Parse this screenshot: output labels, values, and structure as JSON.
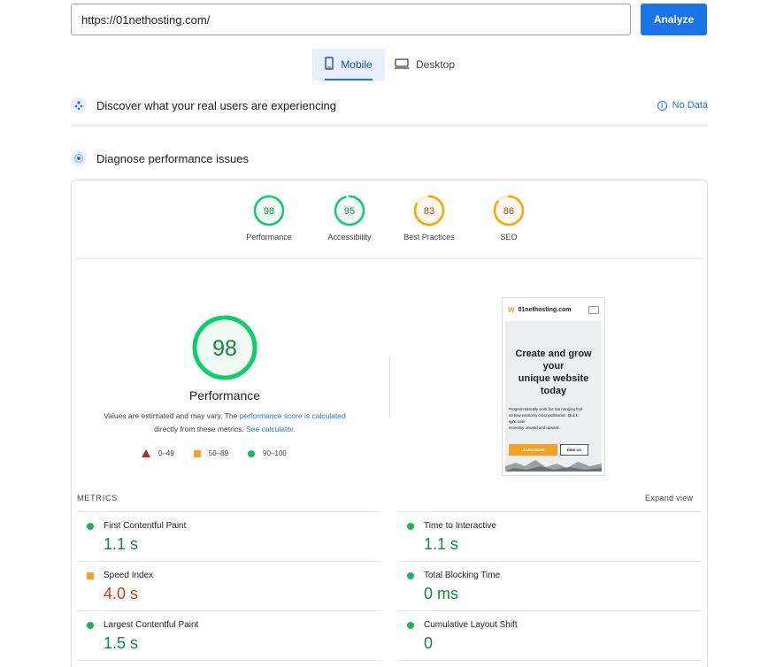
{
  "search": {
    "url": "https://01nethosting.com/",
    "analyze_label": "Analyze"
  },
  "tabs": {
    "mobile": "Mobile",
    "desktop": "Desktop"
  },
  "field_data": {
    "title": "Discover what your real users are experiencing",
    "no_data": "No Data"
  },
  "lab": {
    "title": "Diagnose performance issues"
  },
  "scores": [
    {
      "label": "Performance",
      "value": 98,
      "color": "#0cce6b"
    },
    {
      "label": "Accessibility",
      "value": 95,
      "color": "#0cce6b"
    },
    {
      "label": "Best Practices",
      "value": 83,
      "color": "#ffa400"
    },
    {
      "label": "SEO",
      "value": 86,
      "color": "#ffa400"
    }
  ],
  "main_gauge": {
    "value": 98,
    "label": "Performance",
    "desc_1": "Values are estimated and may vary. The ",
    "desc_link_1": "performance score is calculated",
    "desc_2": "directly from these metrics. ",
    "desc_link_2": "See calculator."
  },
  "legend": {
    "fail": "0–49",
    "average": "50–89",
    "pass": "90–100"
  },
  "screenshot": {
    "site_name": "01nethosting.com",
    "headline_1": "Create and grow",
    "headline_2": "your",
    "headline_3": "unique website",
    "headline_4": "today",
    "body_1": "Programmatically work but low hanging fruit",
    "body_2": "so new economy cross-pollination. Quick",
    "body_3": "sync new",
    "body_4": "economy onward and upward.",
    "btn_primary": "LEARN MORE",
    "btn_secondary": "HIRE US"
  },
  "metrics": {
    "heading": "METRICS",
    "expand": "Expand view",
    "fcp": {
      "name": "First Contentful Paint",
      "value": "1.1 s",
      "status": "pass"
    },
    "tti": {
      "name": "Time to Interactive",
      "value": "1.1 s",
      "status": "pass"
    },
    "si": {
      "name": "Speed Index",
      "value": "4.0 s",
      "status": "average"
    },
    "tbt": {
      "name": "Total Blocking Time",
      "value": "0 ms",
      "status": "pass"
    },
    "lcp": {
      "name": "Largest Contentful Paint",
      "value": "1.5 s",
      "status": "pass"
    },
    "cls": {
      "name": "Cumulative Layout Shift",
      "value": "0",
      "status": "pass"
    }
  },
  "colors": {
    "accent": "#1a73e8",
    "pass": "#0cce6b",
    "average": "#ffa400",
    "fail": "#c5221f"
  }
}
